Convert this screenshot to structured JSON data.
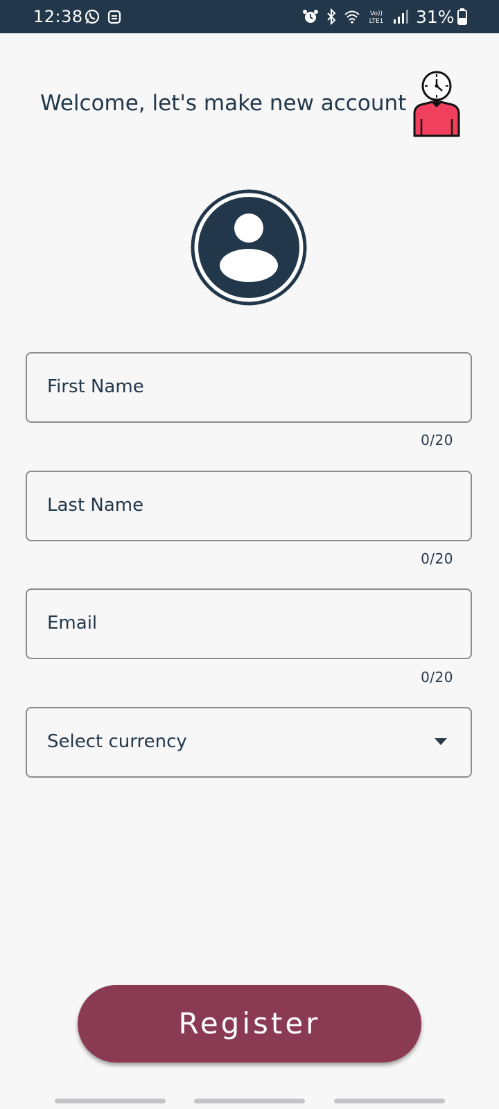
{
  "status_bar": {
    "time": "12:38",
    "battery": "31%",
    "icons": [
      "whatsapp-icon",
      "notification-icon",
      "alarm-icon",
      "bluetooth-icon",
      "wifi-icon",
      "volte-icon",
      "signal-icon",
      "battery-icon"
    ]
  },
  "header": {
    "title": "Welcome, let's make new account",
    "illustration": "person-clock-icon"
  },
  "avatar": {
    "icon": "user-avatar-icon"
  },
  "form": {
    "first_name": {
      "placeholder": "First Name",
      "counter": "0/20"
    },
    "last_name": {
      "placeholder": "Last Name",
      "counter": "0/20"
    },
    "email": {
      "placeholder": "Email",
      "counter": "0/20"
    },
    "currency": {
      "placeholder": "Select currency",
      "icon": "dropdown-arrow-icon"
    }
  },
  "register_button": {
    "label": "Register"
  },
  "colors": {
    "primary": "#22374a",
    "accent": "#8b3a54",
    "illustration_shirt": "#f0405e",
    "background": "#f7f7f8",
    "border": "#8c8c8c"
  }
}
